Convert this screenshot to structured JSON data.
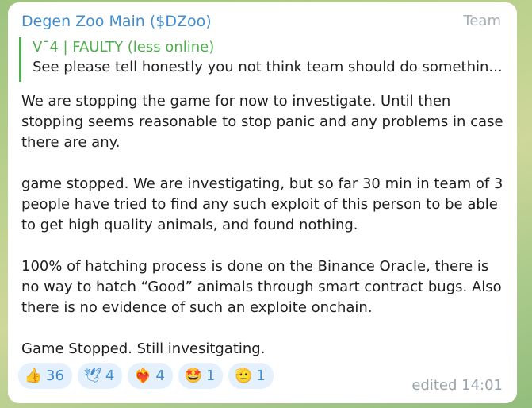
{
  "message": {
    "sender": "Degen Zoo Main ($DZoo)",
    "role": "Team",
    "reply": {
      "author": "V¯4 | FAULTY (less online)",
      "text": "See please tell honestly you not think team should do somethin..."
    },
    "paragraphs": [
      "We are stopping the game for now to investigate.  Until then stopping seems reasonable to stop panic and any problems in case there are any.",
      "game stopped. We are investigating, but so far 30 min in team of 3 people have tried to find any such exploit of this person to be able to get high quality animals, and found nothing.",
      "100% of hatching process is done on the Binance Oracle, there is no way to hatch “Good” animals through smart contract bugs. Also there is no evidence of such an exploite onchain.",
      "Game Stopped. Still invesitgating."
    ],
    "reactions": [
      {
        "emoji": "👍",
        "icon": "thumbs-up",
        "count": "36"
      },
      {
        "emoji": "🕊",
        "icon": "dove",
        "count": "4"
      },
      {
        "emoji": "❤️‍🔥",
        "icon": "heart-on-fire",
        "count": "4"
      },
      {
        "emoji": "🤩",
        "icon": "star-struck",
        "count": "1"
      },
      {
        "emoji": "🫡",
        "icon": "saluting-face",
        "count": "1"
      }
    ],
    "edited_label": "edited 14:01"
  },
  "colors": {
    "sender": "#3f8ccf",
    "reply_accent": "#4fae4e",
    "reaction_bg": "#e4f0fb",
    "meta": "#9aa3aa"
  }
}
